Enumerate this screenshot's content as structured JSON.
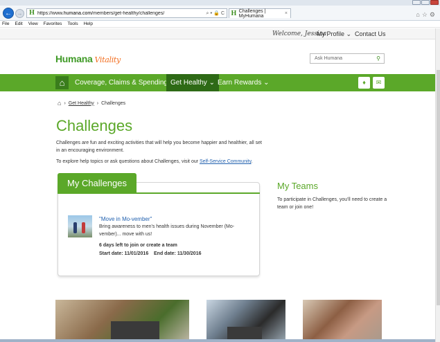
{
  "browser": {
    "url_prefix": "https://www.",
    "url_domain": "humana.com",
    "url_path": "/members/get-healthy/challenges/",
    "url_icons": "⌕ ▾ 🔒 C",
    "tab_title": "Challenges | MyHumana",
    "tab_close": "×",
    "favicon": "H",
    "menu": [
      "File",
      "Edit",
      "View",
      "Favorites",
      "Tools",
      "Help"
    ],
    "right_icons": "⌂☆⚙"
  },
  "top_links": {
    "welcome": "Welcome, Jessica",
    "profile": "My Profile ⌄",
    "contact": "Contact Us"
  },
  "header": {
    "logo_main": "Humana",
    "logo_sub": "Vitality",
    "search_placeholder": "Ask Humana",
    "search_icon": "search-icon"
  },
  "nav": {
    "home_icon": "home-icon",
    "items": [
      {
        "label": "Coverage, Claims & Spending ⌄"
      },
      {
        "label": "Get Healthy ⌄"
      },
      {
        "label": "Earn Rewards ⌄"
      }
    ],
    "bell_icon": "bell-icon",
    "mail_icon": "mail-icon"
  },
  "breadcrumb": {
    "sep": "›",
    "get_healthy": "Get Healthy",
    "current": "Challenges"
  },
  "page": {
    "title": "Challenges",
    "intro": "Challenges are fun and exciting activities that will help you become happier and healthier, all set in an encouraging environment.",
    "help_text": "To explore help topics or ask questions about Challenges, visit our ",
    "help_link": "Self-Service Community",
    "help_end": "."
  },
  "my_challenges": {
    "heading": "My Challenges",
    "item": {
      "title": "\"Move in Mo-vember\"",
      "description": "Bring awareness to men's health issues during November (Mo-vember)... move with us!",
      "days_left": "6 days left to join or create a team",
      "start_label": "Start date: 11/01/2016",
      "end_label": "End date: 11/30/2016"
    }
  },
  "my_teams": {
    "heading": "My Teams",
    "text": "To participate in Challenges, you'll need to create a team or join one!"
  },
  "colors": {
    "brand_green": "#5ba829",
    "dark_green": "#2e6a16",
    "vitality_orange": "#f26f21",
    "link_blue": "#1f5fae"
  }
}
